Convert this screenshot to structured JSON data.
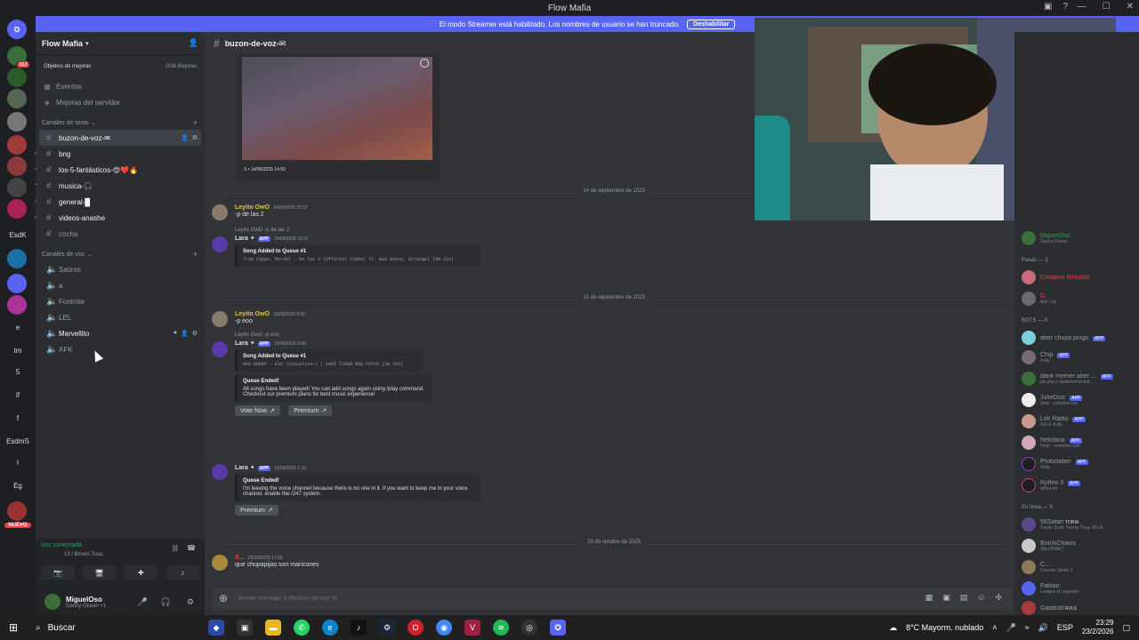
{
  "window": {
    "title": "Flow Mafia"
  },
  "banner": {
    "text": "El modo Streamer está habilitado. Los nombres de usuario se han truncado.",
    "button": "Deshabilitar"
  },
  "guilds": [
    {
      "label": "",
      "badge": "117",
      "color": "#3a6e3a"
    },
    {
      "label": "",
      "badge": "",
      "color": "#2b5a2b"
    },
    {
      "label": "",
      "badge": "",
      "color": "#556655"
    },
    {
      "label": "",
      "badge": "",
      "color": "#777777"
    },
    {
      "label": "",
      "badge": "",
      "color": "#a23a3a"
    },
    {
      "label": "",
      "badge": "",
      "color": "#8a3a3a"
    },
    {
      "label": "",
      "badge": "",
      "color": "#444444"
    },
    {
      "label": "",
      "badge": "",
      "color": "#6a6a6a"
    },
    {
      "label": "",
      "badge": "",
      "color": "#aa2255"
    }
  ],
  "guild_texts": [
    "EsdK",
    "e",
    "tm",
    "5",
    "if",
    "f",
    "EsdmS",
    "l",
    "Eg"
  ],
  "nuevo_badge": "NUEVO",
  "sidebar": {
    "server_name": "Flow Mafia",
    "boost_label": "Objetivo de mejoras",
    "boost_count": "0/36 Mejoras",
    "top_items": [
      {
        "label": "Eventos",
        "icon": "calendar-icon"
      },
      {
        "label": "Mejoras del servidor",
        "icon": "boost-icon"
      }
    ],
    "text_category": "Canales de texto",
    "text_channels": [
      {
        "name": "buzon-de-voz-✉",
        "active": true
      },
      {
        "name": "bng",
        "active": false
      },
      {
        "name": "los-5-fantásticos-😍❤️🔥",
        "active": false
      },
      {
        "name": "musica-🎧",
        "active": false
      },
      {
        "name": "general-█",
        "active": false
      },
      {
        "name": "videos-anashe",
        "active": false
      },
      {
        "name": "cocha",
        "active": false
      }
    ],
    "voice_category": "Canales de voz",
    "voice_channels": [
      {
        "name": "Satiros"
      },
      {
        "name": "a"
      },
      {
        "name": "Fontnite"
      },
      {
        "name": "LEL"
      },
      {
        "name": "Marvellito"
      },
      {
        "name": "AFK"
      }
    ]
  },
  "voice": {
    "status": "Voz conectada",
    "channel": "13 / Brown Toxic"
  },
  "user": {
    "name": "MiguelOso",
    "status": "Danny Ocean +1"
  },
  "channel": {
    "name": "buzon-de-voz-✉"
  },
  "embed_image": {
    "caption": "X • 14/05/2025 14:50"
  },
  "messages": {
    "date1": "14 de septiembre de 2025",
    "m1": {
      "author": "Leyito OwO",
      "ts": "14/09/2025 23:37",
      "text": "-p de las 2"
    },
    "m2": {
      "reply": "Leyito OwO -p de las 2",
      "author": "Lara ✦",
      "badge": "APP",
      "ts": "14/09/2025 23:37",
      "embed_title": "Song Added to Queue #1",
      "embed_desc": "Trap Cappo, Mordel - De las 2 (Official Video) ft. Bad Bunny, Arcangel [4m 21s]"
    },
    "date2": "15 de septiembre de 2025",
    "m3": {
      "author": "Leyito OwO",
      "ts": "15/09/2025 0:58",
      "text": "-p eoo"
    },
    "m4": {
      "reply": "Leyito OwO -p eoo",
      "author": "Lara ✦",
      "badge": "APP",
      "ts": "15/09/2025 0:58",
      "embed_title": "Song Added to Queue #1",
      "embed_desc": "BAD BUNNY - EoO (Visualizer) | DeBÍ TiRAR MáS FOToS [3m 26s]",
      "e2_title": "Queue Ended!",
      "e2_text": "All songs have been played! You can add songs again using /play command. Checkout our premium plans for best music experience!",
      "btn1": "Vote Now",
      "btn2": "Premium"
    },
    "m5": {
      "author": "Lara ✦",
      "badge": "APP",
      "ts": "15/09/2025 1:16",
      "e_title": "Queue Ended!",
      "e_text": "I'm leaving the voice channel because there is no one in it. If you want to keep me in your voice channel, enable the /247 system.",
      "btn": "Premium"
    },
    "date3": "23 de octubre de 2025",
    "m6": {
      "author": "S...",
      "ts": "23/10/2025 17:59",
      "text": "que chupapijas son maricones"
    }
  },
  "composer": {
    "placeholder": "Enviar mensaje a #buzon-de-voz-✉"
  },
  "members": {
    "top_member": {
      "name": "MiguelOso",
      "sub": "Danny Ocean"
    },
    "group1": "Panas — 2",
    "panas": [
      {
        "name": "Cristiano Ronaldo",
        "sub": "",
        "color": "#f23f43"
      },
      {
        "name": "G...",
        "sub": "Aim Lab",
        "color": "#f23f43"
      }
    ],
    "group2": "BOTS — 8",
    "bots": [
      {
        "name": "aber chupa pingo",
        "sub": ""
      },
      {
        "name": "Chip",
        "sub": "/help"
      },
      {
        "name": "dank memer aber ...",
        "sub": "pls play | dankmemer.bot"
      },
      {
        "name": "JukeDisc",
        "sub": "/play - jukedisc.xyz"
      },
      {
        "name": "Lofi Radio",
        "sub": "/lofi & /help"
      },
      {
        "name": "Nekotina",
        "sub": "!help · nekotina.com"
      },
      {
        "name": "Probotaber",
        "sub": "/help"
      },
      {
        "name": "Rythm 3",
        "sub": "rythm.fm"
      }
    ],
    "bot_badge": "APP",
    "group3": "En línea — 9",
    "online": [
      {
        "name": "56Satan",
        "tag": "TORIA",
        "sub": "Travis Scott, Young Thug, M.I.A."
      },
      {
        "name": "BnnInChains",
        "tag": "",
        "sub": "VALORANT"
      },
      {
        "name": "C...",
        "tag": "",
        "sub": "Counter-Strike 2"
      },
      {
        "name": "Fabian",
        "tag": "",
        "sub": "League of Legends"
      },
      {
        "name": "Gabitroll",
        "tag": "RVLS",
        "sub": ""
      }
    ]
  },
  "taskbar": {
    "search": "Buscar",
    "weather": "8°C  Mayorm. nublado",
    "lang": "ESP",
    "time": "23:29",
    "date": "23/2/2026"
  },
  "colors": {
    "blurple": "#5865f2",
    "green": "#23a55a",
    "red": "#f23f43",
    "lara": "#dbdee1",
    "leyito": "#e8c245"
  }
}
